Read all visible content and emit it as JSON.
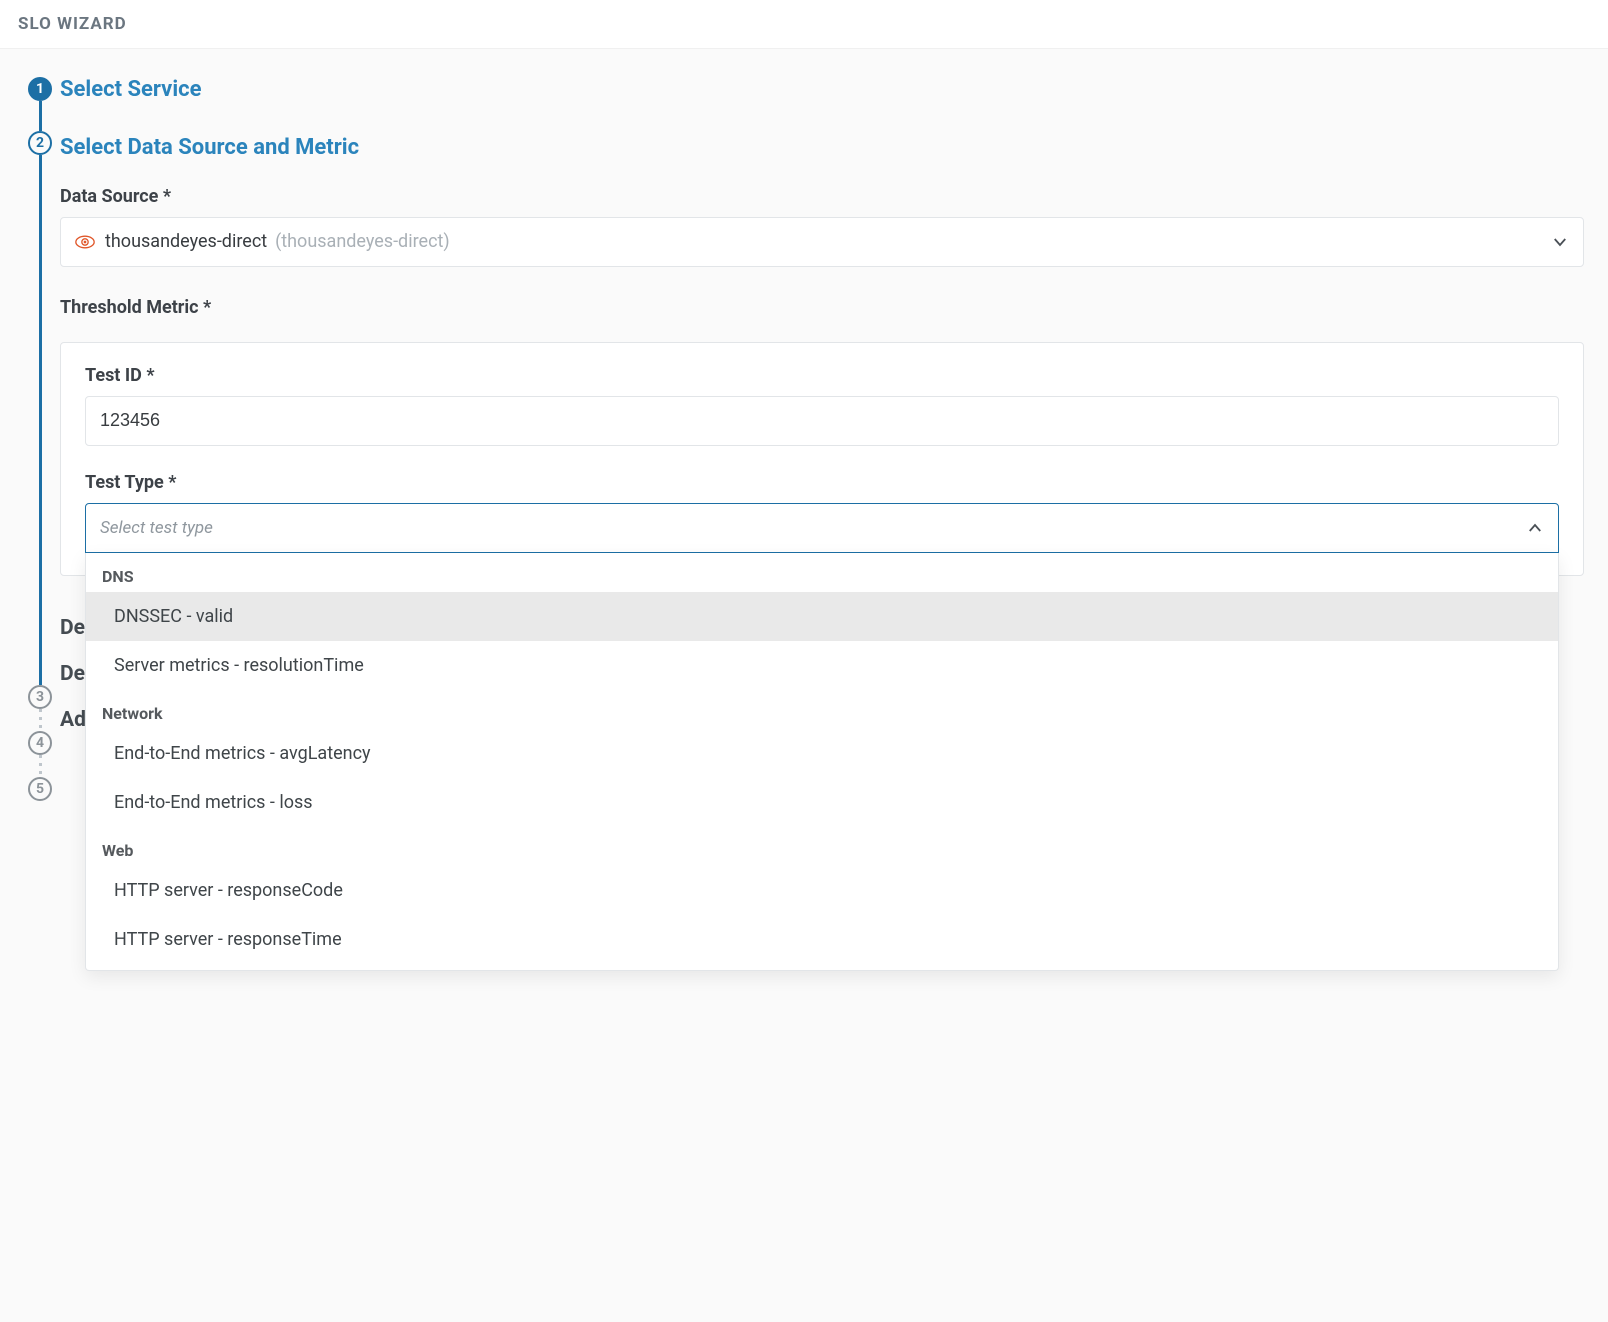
{
  "header": {
    "title": "SLO WIZARD"
  },
  "steps": {
    "s1": {
      "num": "1",
      "title": "Select Service"
    },
    "s2": {
      "num": "2",
      "title": "Select Data Source and Metric"
    },
    "s3": {
      "num": "3",
      "title": "De"
    },
    "s4": {
      "num": "4",
      "title": "De"
    },
    "s5": {
      "num": "5",
      "title": "Ad"
    }
  },
  "form": {
    "dataSourceLabel": "Data Source",
    "dataSource": {
      "name": "thousandeyes-direct",
      "suffix": "(thousandeyes-direct)"
    },
    "thresholdMetricLabel": "Threshold Metric",
    "testIdLabel": "Test ID",
    "testIdValue": "123456",
    "testTypeLabel": "Test Type",
    "testTypePlaceholder": "Select test type",
    "dropdown": {
      "groups": [
        {
          "label": "DNS",
          "items": [
            {
              "label": "DNSSEC - valid",
              "highlight": true
            },
            {
              "label": "Server metrics - resolutionTime",
              "highlight": false
            }
          ]
        },
        {
          "label": "Network",
          "items": [
            {
              "label": "End-to-End metrics - avgLatency",
              "highlight": false
            },
            {
              "label": "End-to-End metrics - loss",
              "highlight": false
            }
          ]
        },
        {
          "label": "Web",
          "items": [
            {
              "label": "HTTP server - responseCode",
              "highlight": false
            },
            {
              "label": "HTTP server - responseTime",
              "highlight": false
            }
          ]
        }
      ]
    }
  }
}
